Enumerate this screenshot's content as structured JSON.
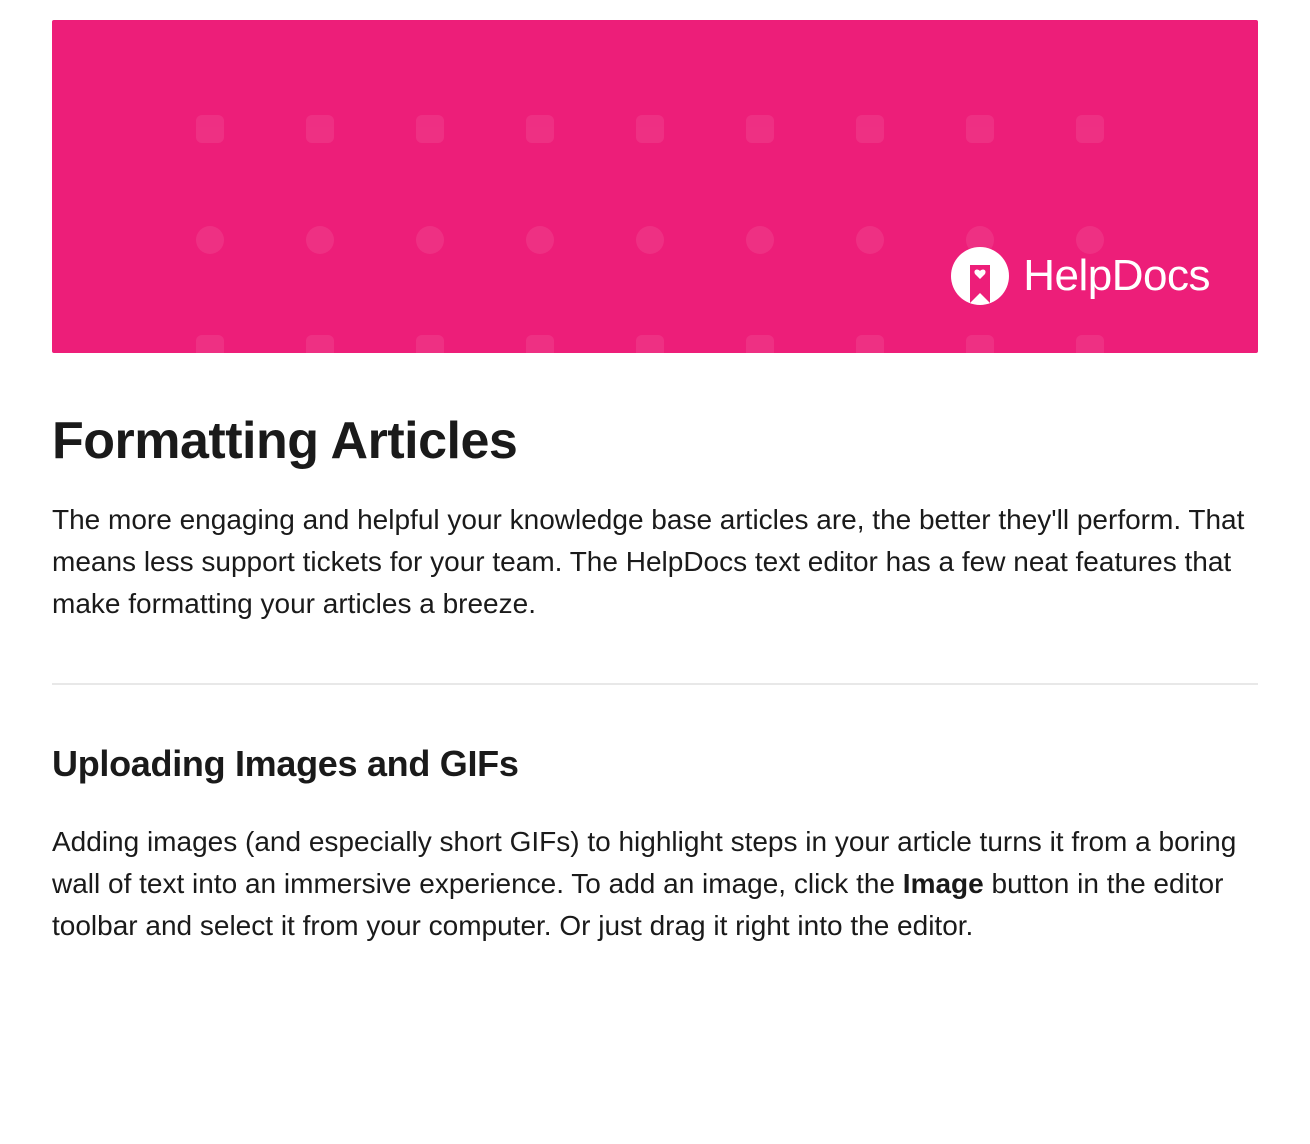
{
  "banner": {
    "brand_name": "HelpDocs",
    "background_color": "#ed1e79"
  },
  "article": {
    "title": "Formatting Articles",
    "intro": "The more engaging and helpful your knowledge base articles are, the better they'll perform. That means less support tickets for your team. The HelpDocs text editor has a few neat features that make formatting your articles a breeze."
  },
  "section1": {
    "heading": "Uploading Images and GIFs",
    "body_part1": "Adding images (and especially short GIFs) to highlight steps in your article turns it from a boring wall of text into an immersive experience. To add an image, click the ",
    "body_bold": "Image",
    "body_part2": " button in the editor toolbar and select it from your computer. Or just drag it right into the editor."
  }
}
